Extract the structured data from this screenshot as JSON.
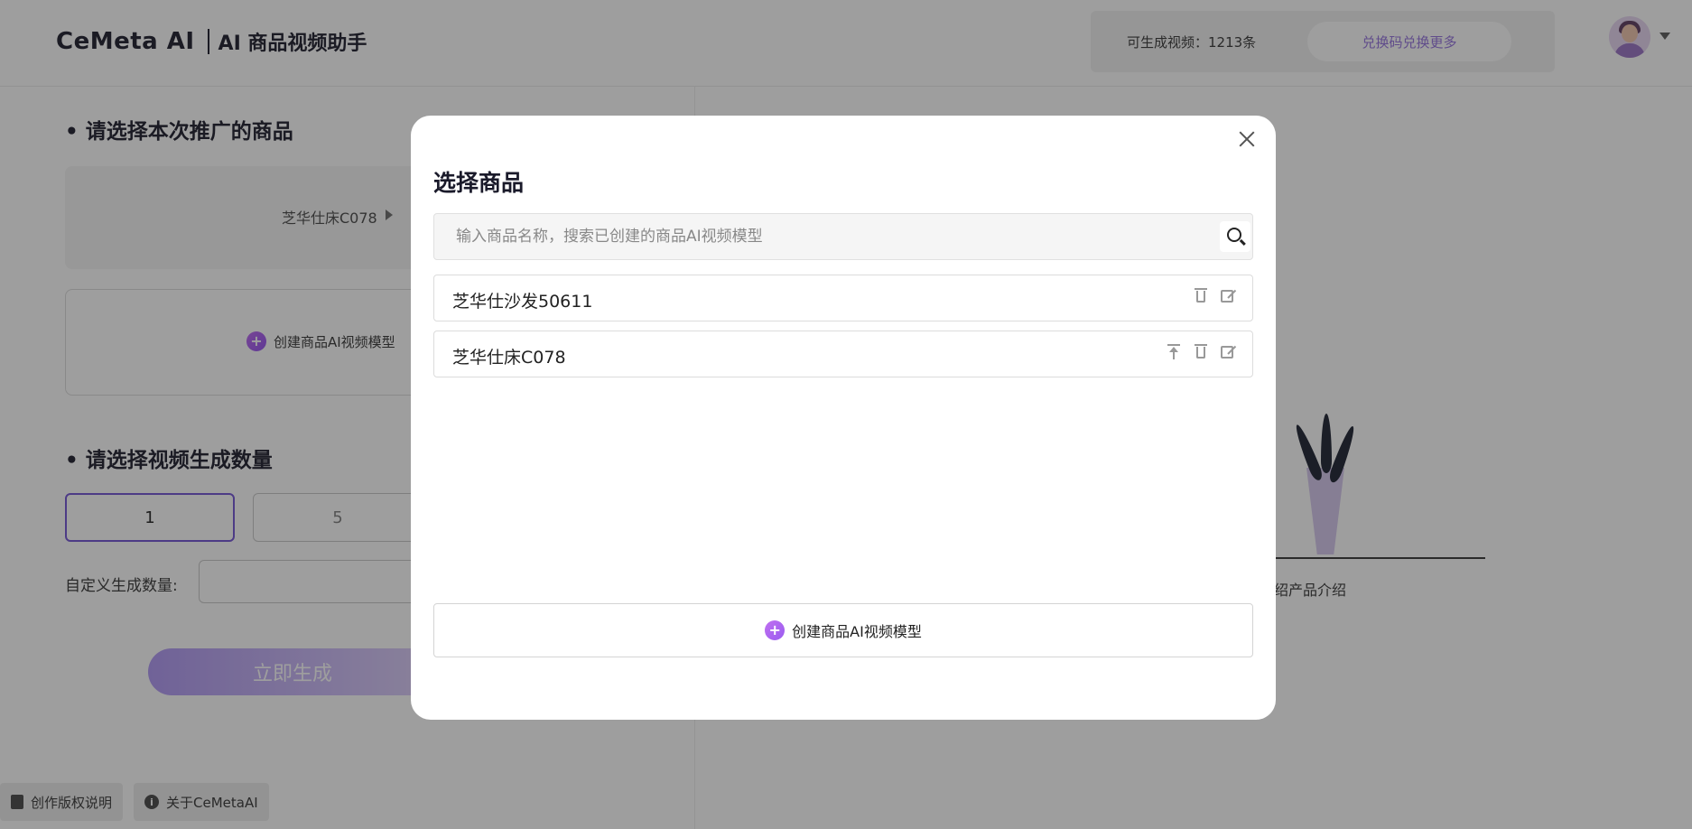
{
  "header": {
    "brand_name": "CeMeta AI",
    "product_name": "AI 商品视频助手",
    "quota_text": "可生成视频：1213条",
    "redeem_label": "兑换码兑换更多"
  },
  "left_panel": {
    "product_section_title": "• 请选择本次推广的商品",
    "selected_product": "芝华仕床C078",
    "create_model_label": "创建商品AI视频模型",
    "quantity_section_title": "• 请选择视频生成数量",
    "quantity_options": [
      "1",
      "5"
    ],
    "selected_quantity": "1",
    "custom_quantity_label": "自定义生成数量:",
    "custom_quantity_value": "",
    "generate_label": "立即生成",
    "footer": {
      "copyright_label": "创作版权说明",
      "about_label": "关于CeMetaAI"
    }
  },
  "right_area": {
    "caption": "绍产品介绍"
  },
  "modal": {
    "title": "选择商品",
    "search_placeholder": "输入商品名称，搜索已创建的商品AI视频模型",
    "search_value": "",
    "products": [
      {
        "name": "芝华仕沙发50611",
        "actions": [
          "delete",
          "edit"
        ]
      },
      {
        "name": "芝华仕床C078",
        "actions": [
          "pin-top",
          "delete",
          "edit"
        ]
      }
    ],
    "create_label": "创建商品AI视频模型"
  },
  "colors": {
    "accent": "#7d5fd9",
    "plus_gradient_start": "#c070f0",
    "plus_gradient_end": "#9a5cf0",
    "overlay": "rgba(0,0,0,0.38)"
  }
}
